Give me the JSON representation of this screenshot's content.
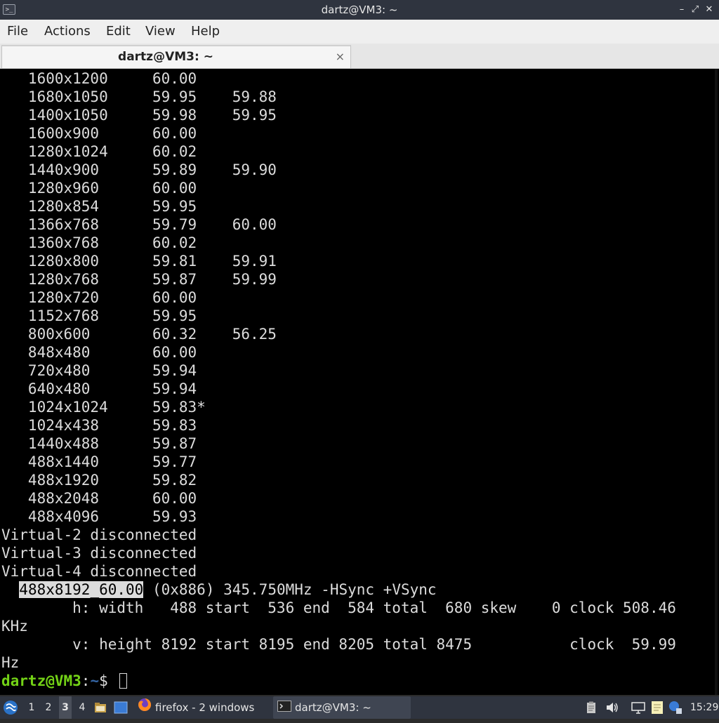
{
  "window": {
    "title": "dartz@VM3: ~",
    "controls": {
      "minimize": "–",
      "maximize": "⤢",
      "close": "✕"
    }
  },
  "menubar": {
    "items": [
      "File",
      "Actions",
      "Edit",
      "View",
      "Help"
    ]
  },
  "tab": {
    "label": "dartz@VM3: ~",
    "close": "×"
  },
  "terminal": {
    "modes": [
      [
        "1600x1200",
        "60.00",
        ""
      ],
      [
        "1680x1050",
        "59.95",
        "59.88"
      ],
      [
        "1400x1050",
        "59.98",
        "59.95"
      ],
      [
        "1600x900",
        "60.00",
        ""
      ],
      [
        "1280x1024",
        "60.02",
        ""
      ],
      [
        "1440x900",
        "59.89",
        "59.90"
      ],
      [
        "1280x960",
        "60.00",
        ""
      ],
      [
        "1280x854",
        "59.95",
        ""
      ],
      [
        "1366x768",
        "59.79",
        "60.00"
      ],
      [
        "1360x768",
        "60.02",
        ""
      ],
      [
        "1280x800",
        "59.81",
        "59.91"
      ],
      [
        "1280x768",
        "59.87",
        "59.99"
      ],
      [
        "1280x720",
        "60.00",
        ""
      ],
      [
        "1152x768",
        "59.95",
        ""
      ],
      [
        "800x600",
        "60.32",
        "56.25"
      ],
      [
        "848x480",
        "60.00",
        ""
      ],
      [
        "720x480",
        "59.94",
        ""
      ],
      [
        "640x480",
        "59.94",
        ""
      ],
      [
        "1024x1024",
        "59.83*",
        ""
      ],
      [
        "1024x438",
        "59.83",
        ""
      ],
      [
        "1440x488",
        "59.87",
        ""
      ],
      [
        "488x1440",
        "59.77",
        ""
      ],
      [
        "488x1920",
        "59.82",
        ""
      ],
      [
        "488x2048",
        "60.00",
        ""
      ],
      [
        "488x4096",
        "59.93",
        ""
      ]
    ],
    "outputs": [
      "Virtual-2 disconnected",
      "Virtual-3 disconnected",
      "Virtual-4 disconnected"
    ],
    "modeline": {
      "name": "488x8192_60.00",
      "rest": " (0x886) 345.750MHz -HSync +VSync"
    },
    "detail_lines": [
      "        h: width   488 start  536 end  584 total  680 skew    0 clock 508.46",
      "KHz",
      "        v: height 8192 start 8195 end 8205 total 8475           clock  59.99",
      "Hz"
    ],
    "prompt": {
      "user": "dartz@VM3",
      "sep": ":",
      "path": "~",
      "symbol": "$ "
    }
  },
  "taskbar": {
    "workspaces": [
      "1",
      "2",
      "3",
      "4"
    ],
    "active_workspace": "3",
    "tasks": [
      {
        "label": "firefox - 2 windows",
        "icon": "firefox-icon"
      },
      {
        "label": "dartz@VM3: ~",
        "icon": "terminal-icon"
      }
    ],
    "clock": "15:29"
  }
}
